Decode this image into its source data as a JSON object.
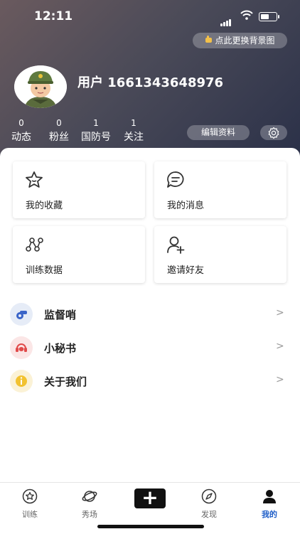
{
  "status_bar": {
    "time": "12:11"
  },
  "header": {
    "bg_button": "点此更换背景图",
    "username": "用户 1661343648976",
    "stats": [
      {
        "value": "0",
        "label": "动态"
      },
      {
        "value": "0",
        "label": "粉丝"
      },
      {
        "value": "1",
        "label": "国防号"
      },
      {
        "value": "1",
        "label": "关注"
      }
    ],
    "edit_button": "编辑资料"
  },
  "cards": [
    {
      "label": "我的收藏",
      "icon": "star-icon"
    },
    {
      "label": "我的消息",
      "icon": "message-icon"
    },
    {
      "label": "训练数据",
      "icon": "graph-icon"
    },
    {
      "label": "邀请好友",
      "icon": "add-user-icon"
    }
  ],
  "menu": [
    {
      "label": "监督哨",
      "icon": "whistle-icon",
      "chevron": ">"
    },
    {
      "label": "小秘书",
      "icon": "headset-icon",
      "chevron": ">"
    },
    {
      "label": "关于我们",
      "icon": "info-icon",
      "chevron": ">"
    }
  ],
  "tabbar": {
    "items": [
      {
        "label": "训练",
        "icon": "star-circle-icon"
      },
      {
        "label": "秀场",
        "icon": "planet-icon"
      },
      {
        "label": "",
        "icon": "plus-icon"
      },
      {
        "label": "发现",
        "icon": "compass-icon"
      },
      {
        "label": "我的",
        "icon": "person-icon"
      }
    ],
    "plus": "+",
    "active_color": "#1e5ec8"
  }
}
